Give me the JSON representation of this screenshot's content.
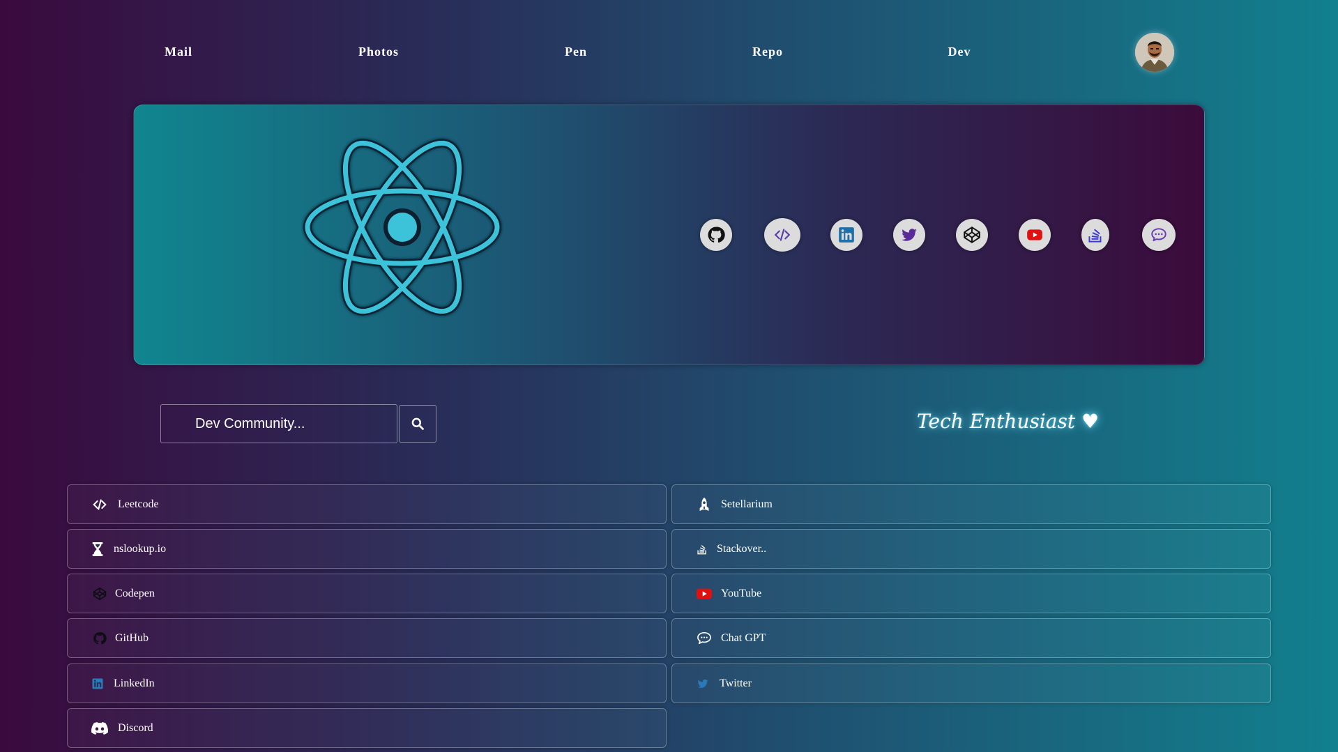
{
  "nav": {
    "links": [
      {
        "label": "Mail"
      },
      {
        "label": "Photos"
      },
      {
        "label": "Pen"
      },
      {
        "label": "Repo"
      },
      {
        "label": "Dev"
      }
    ],
    "avatar_icon": "user-avatar"
  },
  "hero": {
    "logo_icon": "react-atom-icon",
    "logo_color": "#3cc3da",
    "social_icons": [
      {
        "name": "github-icon",
        "color": "#111111"
      },
      {
        "name": "code-icon",
        "color": "#5a3fa8"
      },
      {
        "name": "linkedin-icon",
        "color": "#1f6fa8"
      },
      {
        "name": "twitter-icon",
        "color": "#5a2a9a"
      },
      {
        "name": "codepen-icon",
        "color": "#111111"
      },
      {
        "name": "youtube-icon",
        "color": "#e01010"
      },
      {
        "name": "stackoverflow-icon",
        "color": "#3a38d8"
      },
      {
        "name": "chat-icon",
        "color": "#6a3ab8"
      }
    ]
  },
  "search": {
    "placeholder": "Dev Community...",
    "button_icon": "search-icon"
  },
  "tagline": "Tech Enthusiast ♥",
  "links": {
    "left": [
      {
        "label": "Leetcode",
        "icon": "code-icon"
      },
      {
        "label": "nslookup.io",
        "icon": "hourglass-icon"
      },
      {
        "label": "Codepen",
        "icon": "codepen-icon"
      },
      {
        "label": "GitHub",
        "icon": "github-icon"
      },
      {
        "label": "LinkedIn",
        "icon": "linkedin-icon"
      },
      {
        "label": "Discord",
        "icon": "discord-icon"
      }
    ],
    "right": [
      {
        "label": "Setellarium",
        "icon": "rocket-icon"
      },
      {
        "label": "Stackover..",
        "icon": "stackoverflow-icon"
      },
      {
        "label": "YouTube",
        "icon": "youtube-icon"
      },
      {
        "label": "Chat GPT",
        "icon": "chat-icon"
      },
      {
        "label": "Twitter",
        "icon": "twitter-icon"
      }
    ]
  }
}
